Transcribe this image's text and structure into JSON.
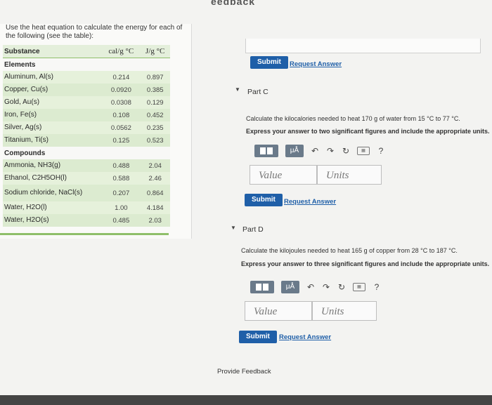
{
  "header": {
    "title": "eedback"
  },
  "table": {
    "intro": "Use the heat equation to calculate the energy for each of the following (see the table):",
    "columns": [
      "Substance",
      "cal/g °C",
      "J/g °C"
    ],
    "section_elements": "Elements",
    "elements": [
      {
        "name": "Aluminum, Al(s)",
        "cal": "0.214",
        "j": "0.897"
      },
      {
        "name": "Copper, Cu(s)",
        "cal": "0.0920",
        "j": "0.385"
      },
      {
        "name": "Gold, Au(s)",
        "cal": "0.0308",
        "j": "0.129"
      },
      {
        "name": "Iron, Fe(s)",
        "cal": "0.108",
        "j": "0.452"
      },
      {
        "name": "Silver, Ag(s)",
        "cal": "0.0562",
        "j": "0.235"
      },
      {
        "name": "Titanium, Ti(s)",
        "cal": "0.125",
        "j": "0.523"
      }
    ],
    "section_compounds": "Compounds",
    "compounds": [
      {
        "name": "Ammonia, NH3(g)",
        "cal": "0.488",
        "j": "2.04"
      },
      {
        "name": "Ethanol, C2H5OH(l)",
        "cal": "0.588",
        "j": "2.46"
      },
      {
        "name": "Sodium chloride, NaCl(s)",
        "cal": "0.207",
        "j": "0.864"
      },
      {
        "name": "Water, H2O(l)",
        "cal": "1.00",
        "j": "4.184"
      },
      {
        "name": "Water, H2O(s)",
        "cal": "0.485",
        "j": "2.03"
      }
    ]
  },
  "partB": {
    "submit": "Submit",
    "request": "Request Answer"
  },
  "partC": {
    "title": "Part C",
    "question": "Calculate the kilocalories needed to heat 170 g of water from 15 °C to 77 °C.",
    "instruction": "Express your answer to two significant figures and include the appropriate units.",
    "value_placeholder": "Value",
    "units_placeholder": "Units",
    "submit": "Submit",
    "request": "Request Answer"
  },
  "partD": {
    "title": "Part D",
    "question": "Calculate the kilojoules needed to heat 165 g of copper from 28 °C to 187 °C.",
    "instruction": "Express your answer to three significant figures and include the appropriate units.",
    "value_placeholder": "Value",
    "units_placeholder": "Units",
    "submit": "Submit",
    "request": "Request Answer"
  },
  "toolbar": {
    "mu_label": "μÅ",
    "help": "?"
  },
  "footer": {
    "feedback": "Provide Feedback"
  }
}
